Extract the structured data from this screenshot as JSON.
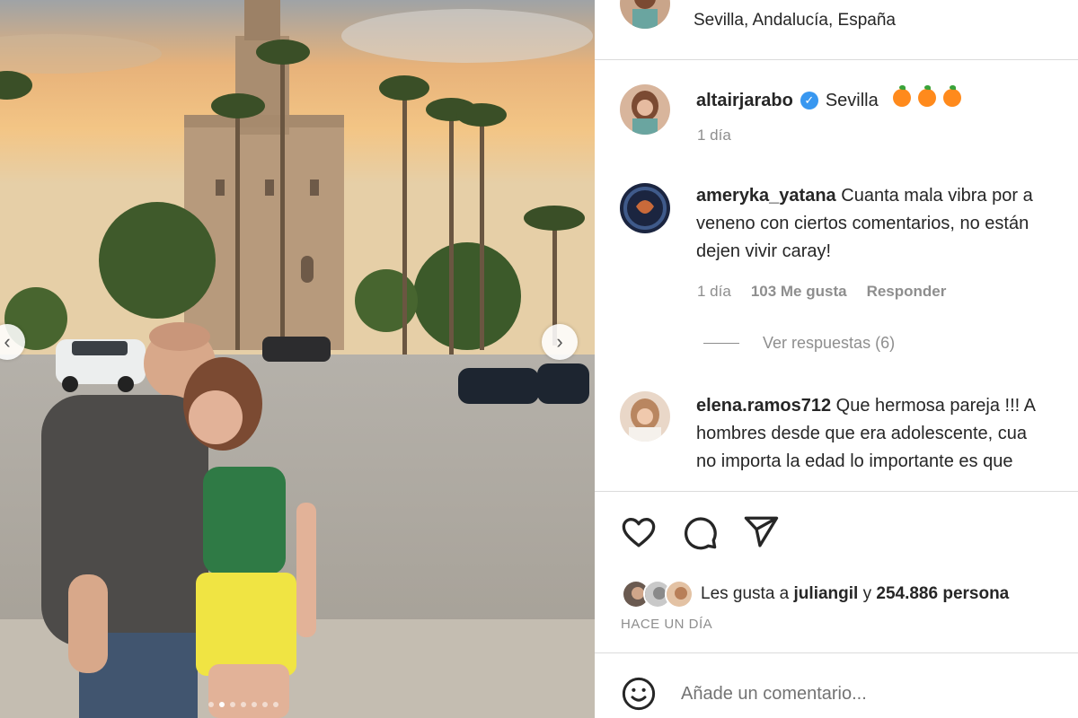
{
  "post": {
    "location": "Sevilla, Andalucía, España",
    "photo_alt": "photo",
    "carousel": {
      "slide_count": 7,
      "active_index": 1
    }
  },
  "caption": {
    "username": "altairjarabo",
    "verified": true,
    "text": "Sevilla",
    "emoji": [
      "orange",
      "orange",
      "orange"
    ],
    "time": "1 día"
  },
  "comments": [
    {
      "username": "ameryka_yatana",
      "lines": [
        "Cuanta mala vibra por a",
        "veneno con ciertos comentarios, no están",
        "dejen vivir caray!"
      ],
      "time": "1 día",
      "likes": "103 Me gusta",
      "reply_label": "Responder",
      "view_replies": "Ver respuestas (6)"
    },
    {
      "username": "elena.ramos712",
      "lines": [
        "Que hermosa pareja !!! A",
        "hombres desde que era adolescente, cua",
        "no importa la edad lo importante es que"
      ]
    }
  ],
  "likes": {
    "prefix": "Les gusta a",
    "user": "juliangil",
    "connector": "y",
    "count": "254.886 persona"
  },
  "posted_ago": "HACE UN DÍA",
  "add_comment": {
    "placeholder": "Añade un comentario..."
  },
  "colors": {
    "verified": "#3897f0",
    "text": "#262626",
    "muted": "#8e8e8e",
    "divider": "#dbdbdb"
  },
  "icons": [
    "heart-icon",
    "comment-icon",
    "share-icon",
    "emoji-icon",
    "chevron-left-icon",
    "chevron-right-icon"
  ]
}
